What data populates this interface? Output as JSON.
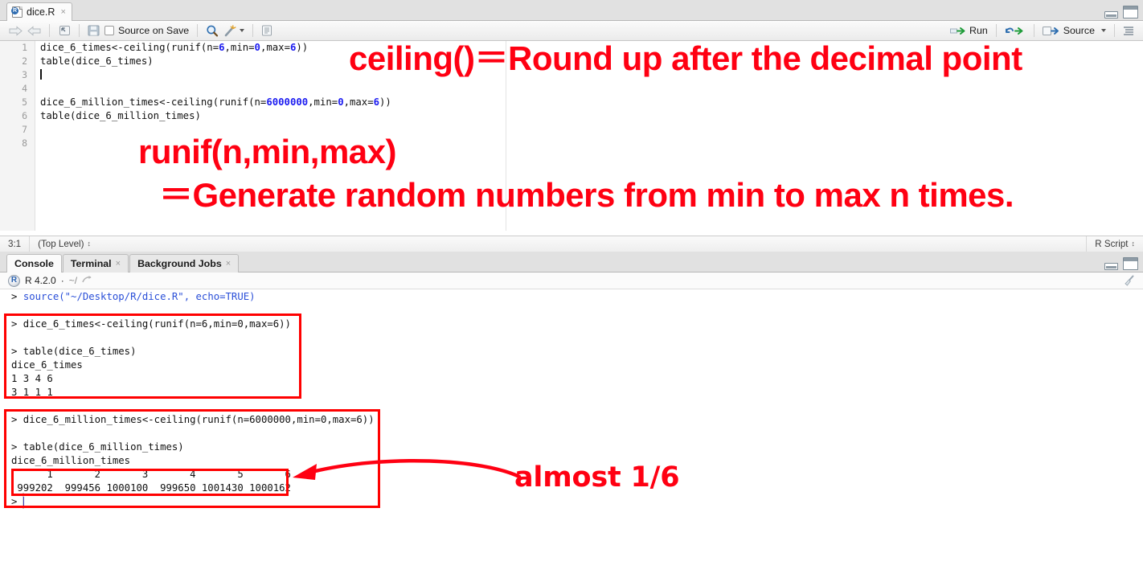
{
  "app": "RStudio",
  "editor": {
    "tab": {
      "filename": "dice.R",
      "close": "×"
    },
    "toolbar": {
      "back_icon": "back-arrow-icon",
      "forward_icon": "forward-arrow-icon",
      "show_doc_outline_icon": "show-in-new-window-icon",
      "save_icon": "save-icon",
      "source_on_save_label": "Source on Save",
      "find_icon": "magnifier-icon",
      "code_tools_icon": "magic-wand-icon",
      "compile_report_icon": "compile-report-icon",
      "run_label": "Run",
      "rerun_icon": "rerun-icon",
      "source_label": "Source",
      "outline_icon": "document-outline-icon"
    },
    "window_controls": {
      "minimize": "minimize-icon",
      "maximize": "maximize-icon"
    },
    "lines": [
      {
        "n": "1",
        "html": "dice_6_times<-ceiling(runif(n=<b class='num'>6</b>,min=<b class='num'>0</b>,max=<b class='num'>6</b>))"
      },
      {
        "n": "2",
        "html": "table(dice_6_times)"
      },
      {
        "n": "3",
        "html": "<span class='caret'></span>"
      },
      {
        "n": "4",
        "html": ""
      },
      {
        "n": "5",
        "html": "dice_6_million_times<-ceiling(runif(n=<b class='num'>6000000</b>,min=<b class='num'>0</b>,max=<b class='num'>6</b>))"
      },
      {
        "n": "6",
        "html": "table(dice_6_million_times)"
      },
      {
        "n": "7",
        "html": ""
      },
      {
        "n": "8",
        "html": ""
      }
    ],
    "plain_lines": [
      "dice_6_times<-ceiling(runif(n=6,min=0,max=6))",
      "table(dice_6_times)",
      "",
      "",
      "dice_6_million_times<-ceiling(runif(n=6000000,min=0,max=6))",
      "table(dice_6_million_times)",
      "",
      ""
    ],
    "statusbar": {
      "cursor_position": "3:1",
      "scope": "(Top Level)",
      "scope_caret": "↕",
      "doc_type": "R Script",
      "doc_type_caret": "↕"
    }
  },
  "console": {
    "tabs": [
      {
        "label": "Console",
        "closable": false,
        "active": true
      },
      {
        "label": "Terminal",
        "closable": true,
        "active": false
      },
      {
        "label": "Background Jobs",
        "closable": true,
        "active": false
      }
    ],
    "close_glyph": "×",
    "header": {
      "r_logo": "r-logo-icon",
      "version": "R 4.2.0",
      "separator": "·",
      "working_dir": "~/",
      "view_dir_icon": "open-in-new-window-icon",
      "clear_icon": "broom-icon"
    },
    "window_controls": {
      "minimize": "minimize-icon",
      "maximize": "maximize-icon"
    },
    "output": [
      {
        "type": "input",
        "text": "> source(\"~/Desktop/R/dice.R\", echo=TRUE)"
      },
      {
        "type": "blank",
        "text": ""
      },
      {
        "type": "input",
        "text": "> dice_6_times<-ceiling(runif(n=6,min=0,max=6))"
      },
      {
        "type": "blank",
        "text": ""
      },
      {
        "type": "input",
        "text": "> table(dice_6_times)"
      },
      {
        "type": "output",
        "text": "dice_6_times"
      },
      {
        "type": "output",
        "text": "1 3 4 6"
      },
      {
        "type": "output",
        "text": "3 1 1 1"
      },
      {
        "type": "blank",
        "text": ""
      },
      {
        "type": "input",
        "text": "> dice_6_million_times<-ceiling(runif(n=6000000,min=0,max=6))"
      },
      {
        "type": "blank",
        "text": ""
      },
      {
        "type": "input",
        "text": "> table(dice_6_million_times)"
      },
      {
        "type": "output",
        "text": "dice_6_million_times"
      },
      {
        "type": "output",
        "text": "      1       2       3       4       5       6 "
      },
      {
        "type": "output",
        "text": " 999202  999456 1000100  999650 1001430 1000162 "
      },
      {
        "type": "prompt",
        "text": "> "
      }
    ],
    "table_result": {
      "categories": [
        "1",
        "2",
        "3",
        "4",
        "5",
        "6"
      ],
      "counts": [
        999202,
        999456,
        1000100,
        999650,
        1001430,
        1000162
      ],
      "total": 6000000,
      "small_sample": {
        "categories": [
          "1",
          "3",
          "4",
          "6"
        ],
        "counts": [
          3,
          1,
          1,
          1
        ]
      }
    }
  },
  "annotations": {
    "color": "#ff0012",
    "ceiling_note": "ceiling()＝Round up after the decimal point",
    "runif_note": "runif(n,min,max)",
    "generate_note": "＝Generate random numbers from min to max n times.",
    "almost_note": "almost 1/6",
    "arrow_icon": "curved-arrow-icon",
    "boxes": [
      {
        "name": "first-dice-result-box"
      },
      {
        "name": "million-dice-result-box"
      },
      {
        "name": "frequency-table-box"
      }
    ]
  }
}
